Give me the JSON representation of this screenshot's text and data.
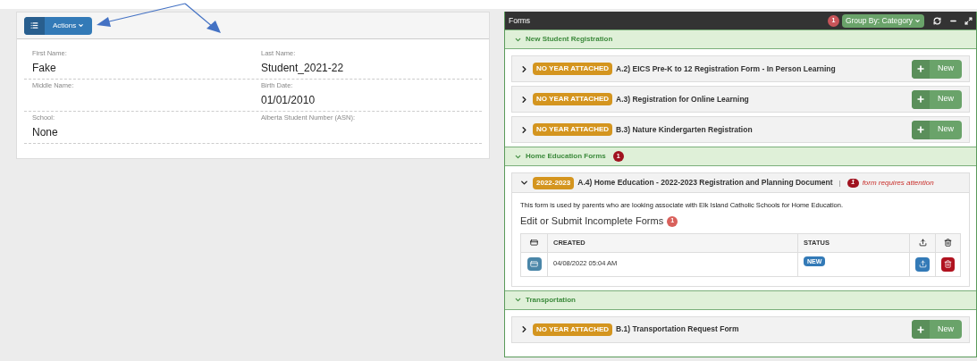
{
  "student": {
    "actions_button": "Actions",
    "fields": [
      {
        "label": "First Name:",
        "value": "Fake"
      },
      {
        "label": "Last Name:",
        "value": "Student_2021-22"
      },
      {
        "label": "Middle Name:"
      },
      {
        "label": "Birth Date:",
        "value": "01/01/2010"
      },
      {
        "label": "School:",
        "value": "None"
      },
      {
        "label": "Alberta Student Number (ASN):"
      }
    ]
  },
  "forms_panel": {
    "title": "Forms",
    "badge": "1",
    "group_by": "Group By: Category",
    "categories": [
      {
        "name": "New Student Registration",
        "expanded": true,
        "forms": [
          {
            "tag": "NO YEAR ATTACHED",
            "title": "A.2) EICS Pre-K to 12 Registration Form - In Person Learning",
            "expanded": false,
            "new_button": "New"
          },
          {
            "tag": "NO YEAR ATTACHED",
            "title": "A.3) Registration for Online Learning",
            "expanded": false,
            "new_button": "New"
          },
          {
            "tag": "NO YEAR ATTACHED",
            "title": "B.3) Nature Kindergarten Registration",
            "expanded": false,
            "new_button": "New"
          }
        ]
      },
      {
        "name": "Home Education Forms",
        "badge": "1",
        "expanded": true,
        "forms": [
          {
            "tag": "2022-2023",
            "title": "A.4) Home Education - 2022-2023 Registration and Planning Document",
            "expanded": true,
            "separator": "|",
            "attention_count": "1",
            "attention_text": "form requires attention",
            "description": "This form is used by parents who are looking associate with Elk Island Catholic Schools for Home Education.",
            "incomplete_title": "Edit or Submit Incomplete Forms",
            "incomplete_count": "1",
            "table": {
              "columns": [
                "CREATED",
                "STATUS"
              ],
              "rows": [
                {
                  "created": "04/08/2022 05:04 AM",
                  "status": "NEW"
                }
              ]
            }
          }
        ]
      },
      {
        "name": "Transportation",
        "expanded": true,
        "forms": [
          {
            "tag": "NO YEAR ATTACHED",
            "title": "B.1) Transportation Request Form",
            "expanded": false,
            "new_button": "New"
          }
        ]
      }
    ]
  }
}
